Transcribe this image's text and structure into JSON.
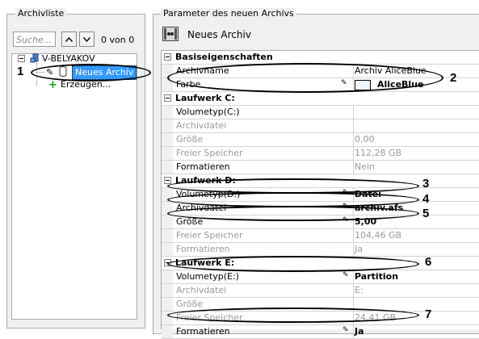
{
  "left_panel": {
    "title": "Archivliste",
    "search_placeholder": "Suche...",
    "counter": "0 von 0",
    "tree": {
      "server": "V-BELYAKOV",
      "archive_item": "Neues Archiv",
      "create_item": "Erzeugen..."
    }
  },
  "right_panel": {
    "title": "Parameter des neuen Archivs",
    "header": "Neues Archiv",
    "sections": {
      "basic": {
        "title": "Basiseigenschaften",
        "archive_name_label": "Archivname",
        "archive_name_value": "Archiv AliceBlue",
        "color_label": "Farbe",
        "color_value": "AliceBlue",
        "color_swatch": "#F0F8FF"
      },
      "drive_c": {
        "title": "Laufwerk C:",
        "volume_type_label": "Volumetyp(C:)",
        "volume_type_value": "",
        "archive_file_label": "Archivdatei",
        "archive_file_value": "",
        "size_label": "Größe",
        "size_value": "0,00",
        "free_label": "Freier Speicher",
        "free_value": "112,28 GB",
        "format_label": "Formatieren",
        "format_value": "Nein"
      },
      "drive_d": {
        "title": "Laufwerk D:",
        "volume_type_label": "Volumetyp(D:)",
        "volume_type_value": "Datei",
        "archive_file_label": "Archivdatei",
        "archive_file_value": "archiv.afs",
        "size_label": "Größe",
        "size_value": "5,00",
        "free_label": "Freier Speicher",
        "free_value": "104,46 GB",
        "format_label": "Formatieren",
        "format_value": "Ja"
      },
      "drive_e": {
        "title": "Laufwerk E:",
        "volume_type_label": "Volumetyp(E:)",
        "volume_type_value": "Partition",
        "archive_file_label": "Archivdatei",
        "archive_file_value": "E:",
        "size_label": "Größe",
        "size_value": "",
        "free_label": "Freier Speicher",
        "free_value": "24,41 GB",
        "format_label": "Formatieren",
        "format_value": "Ja"
      }
    }
  },
  "callouts": [
    "1",
    "2",
    "3",
    "4",
    "5",
    "6",
    "7"
  ],
  "colors": {
    "selection": "#3399ff",
    "create_plus": "#00a000"
  }
}
